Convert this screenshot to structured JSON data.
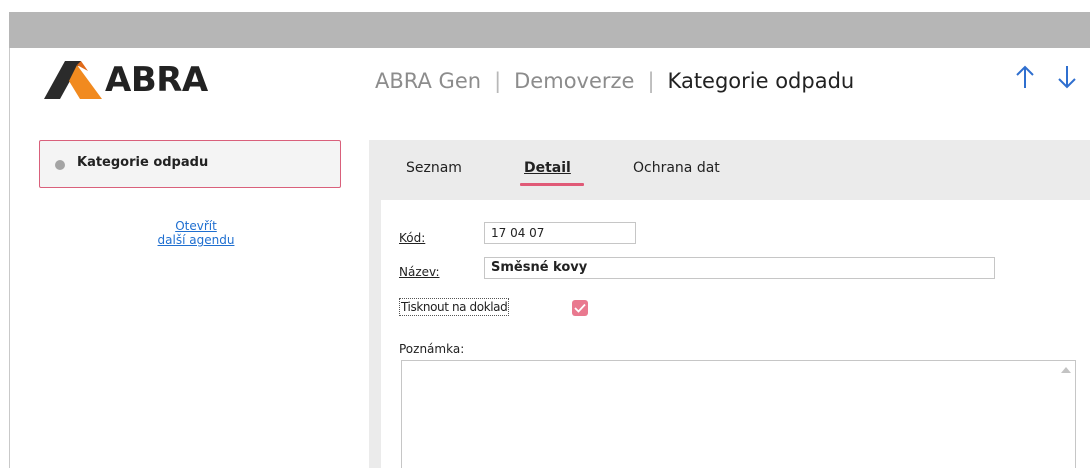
{
  "app": {
    "logo_text": "ABRA",
    "breadcrumbs": [
      "ABRA Gen",
      "Demoverze",
      "Kategorie odpadu"
    ],
    "nav": {
      "up_icon": "arrow-up-icon",
      "down_icon": "arrow-down-icon"
    }
  },
  "sidebar": {
    "active_agenda": "Kategorie odpadu",
    "open_link_line1": "Otevřít",
    "open_link_line2": "další agendu"
  },
  "tabs": [
    {
      "label": "Seznam",
      "active": false
    },
    {
      "label": "Detail",
      "active": true
    },
    {
      "label": "Ochrana dat",
      "active": false
    }
  ],
  "form": {
    "kod_label": "Kód:",
    "kod_value": "17 04 07",
    "nazev_label": "Název:",
    "nazev_value": "Směsné kovy",
    "print_label": "Tisknout na doklad",
    "print_checked": true,
    "note_label": "Poznámka:",
    "note_value": ""
  },
  "colors": {
    "accent": "#e05a77",
    "checkbox": "#e9798f",
    "link": "#1f6fd0",
    "logo_orange": "#f18a1f",
    "logo_dark": "#2b2b2b"
  }
}
